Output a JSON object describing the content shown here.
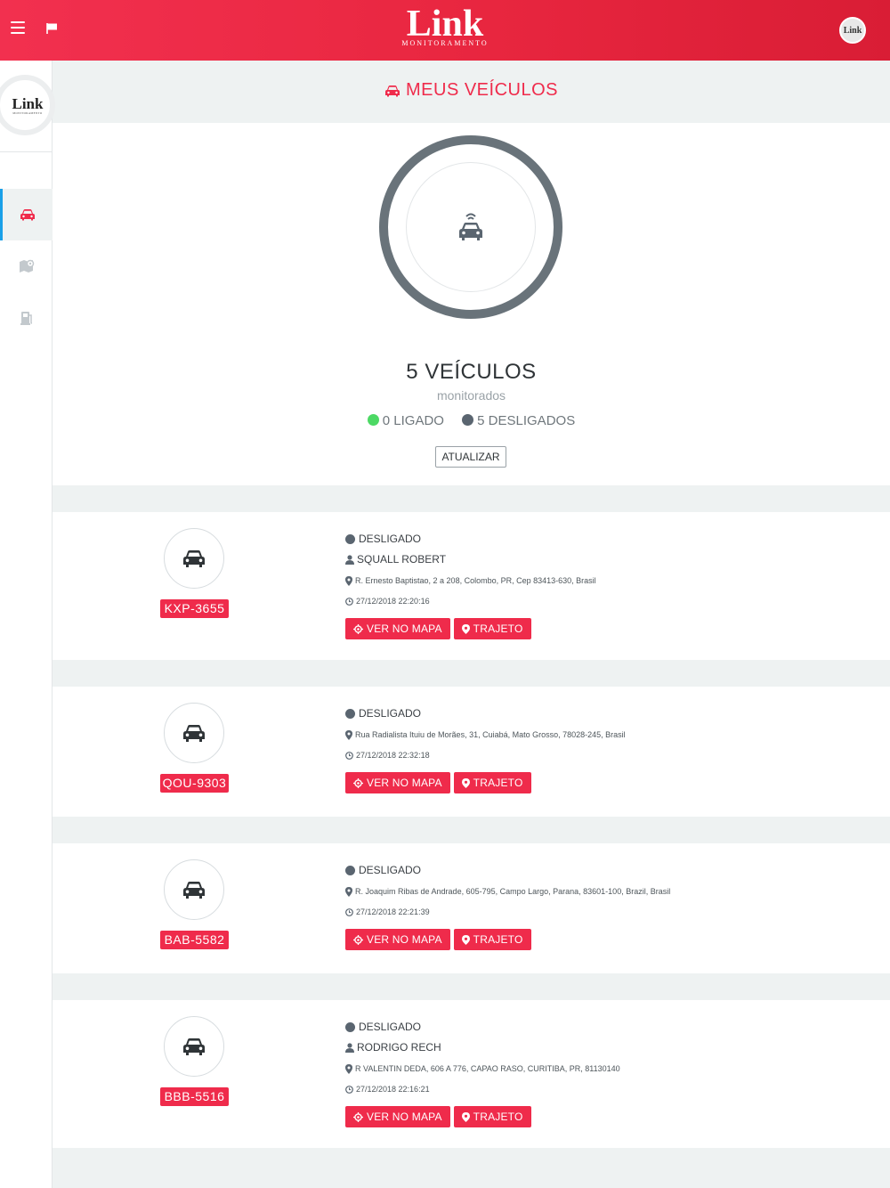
{
  "header": {
    "logo_word": "Link",
    "logo_sub": "MONITORAMENTO",
    "avatar_text": "Link",
    "menu_icon": "hamburger-icon",
    "flag_icon": "flag-icon",
    "brand_color": "#ef2b4b"
  },
  "sidebar": {
    "logo_word": "Link",
    "logo_sub": "MONITORAMENTO",
    "items": [
      {
        "icon": "car-icon",
        "active": true
      },
      {
        "icon": "map-icon",
        "active": false
      },
      {
        "icon": "fuel-icon",
        "active": false
      }
    ]
  },
  "main": {
    "title": "MEUS VEÍCULOS",
    "summary": {
      "count_label": "5 VEÍCULOS",
      "sub_label": "monitorados",
      "on_label": "0 LIGADO",
      "off_label": "5 DESLIGADOS",
      "on_color": "#4cd964",
      "off_color": "#5a6570",
      "refresh_label": "ATUALIZAR"
    },
    "vehicles": [
      {
        "plate": "KXP-3655",
        "status": "DESLIGADO",
        "driver": "SQUALL ROBERT",
        "address": "R. Ernesto Baptistao, 2 a 208, Colombo, PR, Cep 83413-630, Brasil",
        "time": "27/12/2018 22:20:16",
        "map_label": "VER NO MAPA",
        "route_label": "TRAJETO"
      },
      {
        "plate": "QOU-9303",
        "status": "DESLIGADO",
        "driver": "",
        "address": "Rua Radialista Ituiu de Morães, 31, Cuiabá, Mato Grosso, 78028-245, Brasil",
        "time": "27/12/2018 22:32:18",
        "map_label": "VER NO MAPA",
        "route_label": "TRAJETO"
      },
      {
        "plate": "BAB-5582",
        "status": "DESLIGADO",
        "driver": "",
        "address": "R. Joaquim Ribas de Andrade, 605-795, Campo Largo, Parana, 83601-100, Brazil, Brasil",
        "time": "27/12/2018 22:21:39",
        "map_label": "VER NO MAPA",
        "route_label": "TRAJETO"
      },
      {
        "plate": "BBB-5516",
        "status": "DESLIGADO",
        "driver": "RODRIGO RECH",
        "address": "R VALENTIN DEDA, 606 A 776, CAPAO RASO, CURITIBA, PR, 81130140",
        "time": "27/12/2018 22:16:21",
        "map_label": "VER NO MAPA",
        "route_label": "TRAJETO"
      }
    ]
  }
}
